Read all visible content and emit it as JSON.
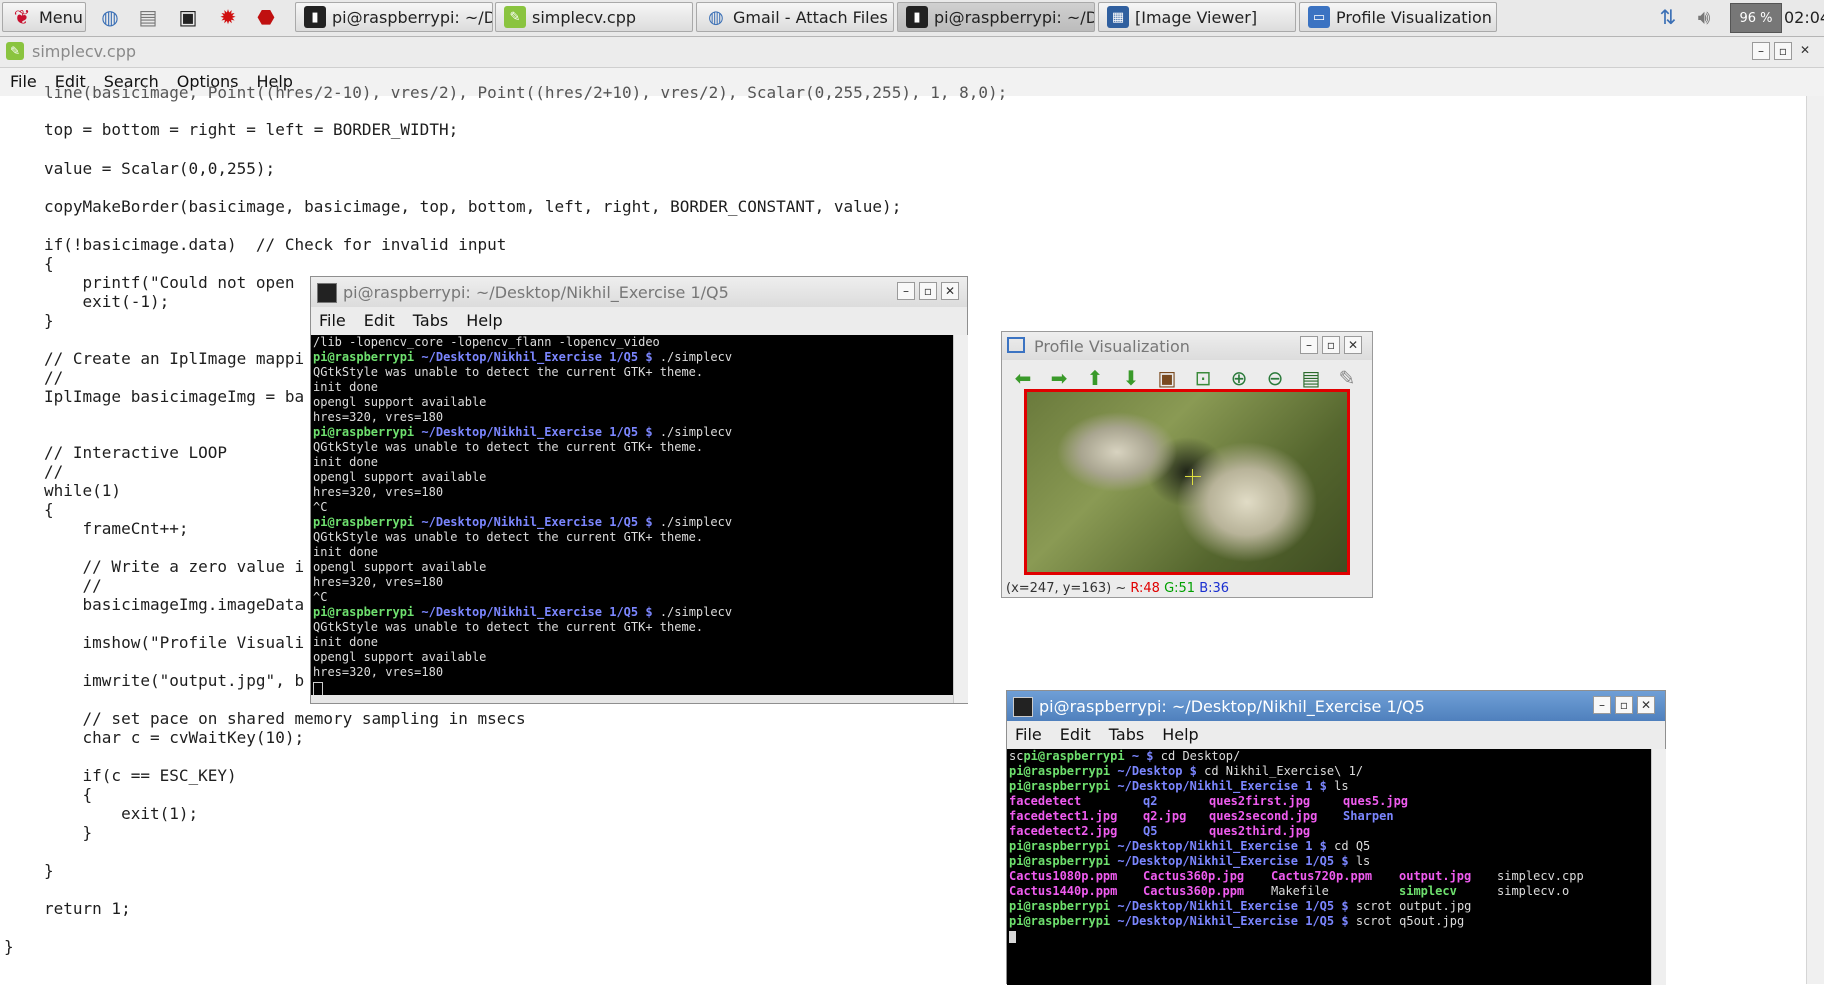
{
  "taskbar": {
    "menu_label": "Menu",
    "tasks": [
      {
        "label": "pi@raspberrypi: ~/De..."
      },
      {
        "label": "simplecv.cpp"
      },
      {
        "label": "Gmail - Attach Files"
      },
      {
        "label": "pi@raspberrypi: ~/De..."
      },
      {
        "label": "[Image Viewer]"
      },
      {
        "label": "Profile Visualization"
      }
    ],
    "battery": "96 %",
    "clock": "02:04"
  },
  "editor": {
    "title": "simplecv.cpp",
    "menu": [
      "File",
      "Edit",
      "Search",
      "Options",
      "Help"
    ],
    "lines": [
      "line(basicimage, Point((hres/2-10), vres/2), Point((hres/2+10), vres/2), Scalar(0,255,255), 1, 8,0);",
      "top = bottom = right = left = BORDER_WIDTH;",
      "value = Scalar(0,0,255);",
      "copyMakeBorder(basicimage, basicimage, top, bottom, left, right, BORDER_CONSTANT, value);",
      "if(!basicimage.data)  // Check for invalid input",
      "{",
      "    printf(\"Could not open",
      "    exit(-1);",
      "}",
      "// Create an IplImage mappi",
      "//",
      "IplImage basicimageImg = ba",
      "// Interactive LOOP",
      "//",
      "while(1)",
      "{",
      "    frameCnt++;",
      "    // Write a zero value i",
      "    //",
      "    basicimageImg.imageData",
      "    imshow(\"Profile Visuali",
      "    imwrite(\"output.jpg\", b",
      "    // set pace on shared memory sampling in msecs",
      "    char c = cvWaitKey(10);",
      "    if(c == ESC_KEY)",
      "    {",
      "        exit(1);",
      "    }",
      "}",
      "return 1;",
      "}"
    ]
  },
  "terminal1": {
    "title": "pi@raspberrypi: ~/Desktop/Nikhil_Exercise 1/Q5",
    "menu": [
      "File",
      "Edit",
      "Tabs",
      "Help"
    ],
    "first_line": "/lib -lopencv_core -lopencv_flann -lopencv_video",
    "prompt_user": "pi@raspberrypi",
    "prompt_path": "~/Desktop/Nikhil_Exercise 1/Q5 $",
    "command": "./simplecv",
    "out_gtk": "QGtkStyle was unable to detect the current GTK+ theme.",
    "out_init": "init done",
    "out_opengl": "opengl support available",
    "out_res": "hres=320, vres=180",
    "out_ctrlc": "^C"
  },
  "terminal2": {
    "title": "pi@raspberrypi: ~/Desktop/Nikhil_Exercise 1/Q5",
    "menu": [
      "File",
      "Edit",
      "Tabs",
      "Help"
    ],
    "l1_pre": "sc",
    "l1_user": "pi@raspberrypi",
    "l1_path": "~ $",
    "l1_cmd": "cd Desktop/",
    "l2_user": "pi@raspberrypi",
    "l2_path": "~/Desktop $",
    "l2_cmd": "cd Nikhil_Exercise\\ 1/",
    "l3_user": "pi@raspberrypi",
    "l3_path": "~/Desktop/Nikhil_Exercise 1 $",
    "l3_cmd": "ls",
    "ls1": [
      [
        "facedetect",
        "q2",
        "ques2first.jpg",
        "ques5.jpg"
      ],
      [
        "facedetect1.jpg",
        "q2.jpg",
        "ques2second.jpg",
        "Sharpen"
      ],
      [
        "facedetect2.jpg",
        "Q5",
        "ques2third.jpg",
        ""
      ]
    ],
    "l7_user": "pi@raspberrypi",
    "l7_path": "~/Desktop/Nikhil_Exercise 1 $",
    "l7_cmd": "cd Q5",
    "l8_user": "pi@raspberrypi",
    "l8_path": "~/Desktop/Nikhil_Exercise 1/Q5 $",
    "l8_cmd": "ls",
    "ls2": [
      [
        "Cactus1080p.ppm",
        "Cactus360p.jpg",
        "Cactus720p.ppm",
        "output.jpg",
        "simplecv.cpp"
      ],
      [
        "Cactus1440p.ppm",
        "Cactus360p.ppm",
        "Makefile",
        "simplecv",
        "simplecv.o"
      ]
    ],
    "l11_user": "pi@raspberrypi",
    "l11_path": "~/Desktop/Nikhil_Exercise 1/Q5 $",
    "l11_cmd": "scrot output.jpg",
    "l12_user": "pi@raspberrypi",
    "l12_path": "~/Desktop/Nikhil_Exercise 1/Q5 $",
    "l12_cmd": "scrot q5out.jpg"
  },
  "profile_viz": {
    "title": "Profile Visualization",
    "status_coords": "(x=247, y=163) ~",
    "status_r": "R:48",
    "status_g": "G:51",
    "status_b": "B:36",
    "colors": {
      "r": "#e00000",
      "g": "#00a000",
      "b": "#1a2fd0"
    }
  }
}
